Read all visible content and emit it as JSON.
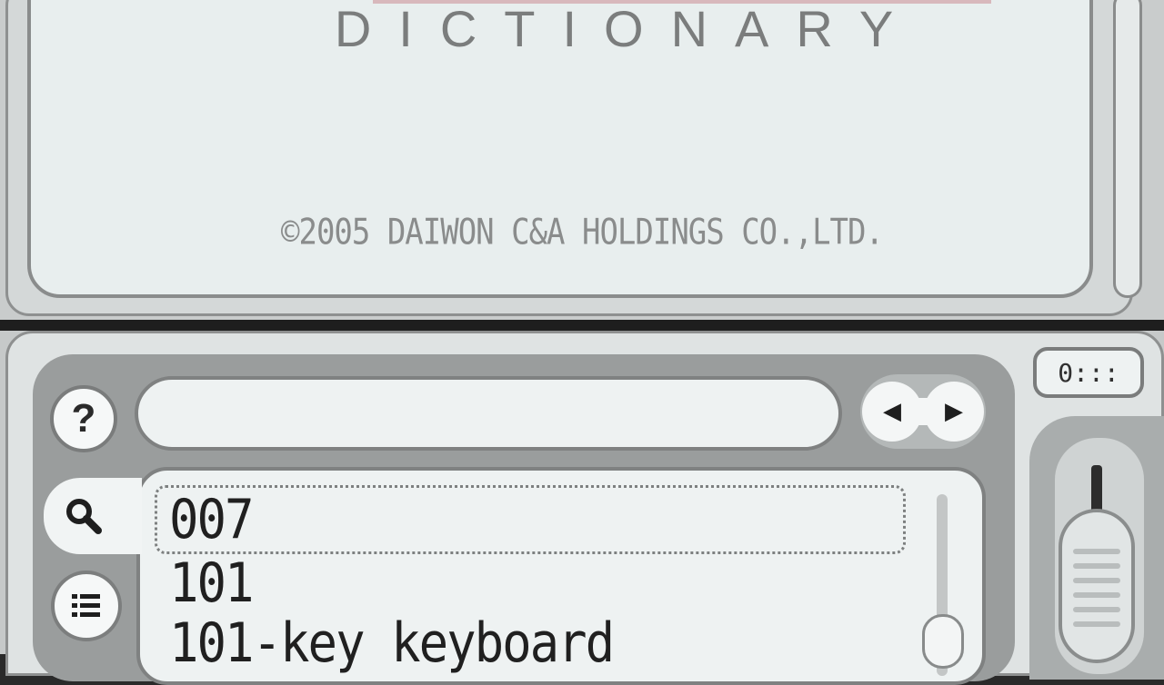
{
  "top_screen": {
    "title": "DICTIONARY",
    "copyright": "©2005 DAIWON C&A HOLDINGS CO.,LTD."
  },
  "toolbar": {
    "help_label": "?",
    "search_value": "",
    "mode_label": "0:::"
  },
  "results": [
    "007",
    "101",
    "101-key keyboard"
  ],
  "selected_index": 0,
  "colors": {
    "panel_bg": "#eef2f2",
    "border": "#7f8181",
    "text": "#202020"
  },
  "icons": {
    "search_tab": "magnifier-icon",
    "list_tab": "list-icon",
    "prev": "triangle-left-icon",
    "next": "triangle-right-icon"
  }
}
